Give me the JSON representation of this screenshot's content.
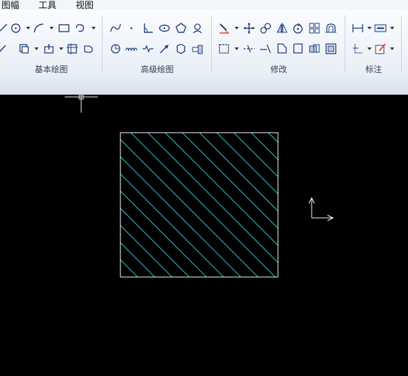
{
  "menu": {
    "items": [
      "图幅",
      "工具",
      "视图"
    ]
  },
  "ribbon": {
    "groups": [
      {
        "id": "basic",
        "label": "基本绘图"
      },
      {
        "id": "advanced",
        "label": "高级绘图"
      },
      {
        "id": "modify",
        "label": "修改"
      },
      {
        "id": "annotate",
        "label": "标注"
      }
    ]
  },
  "canvas": {
    "background": "#000000",
    "hatch_color": "#33c6d4",
    "boundary_color": "#ffffff",
    "hatch_pattern": "diagonal-45"
  }
}
